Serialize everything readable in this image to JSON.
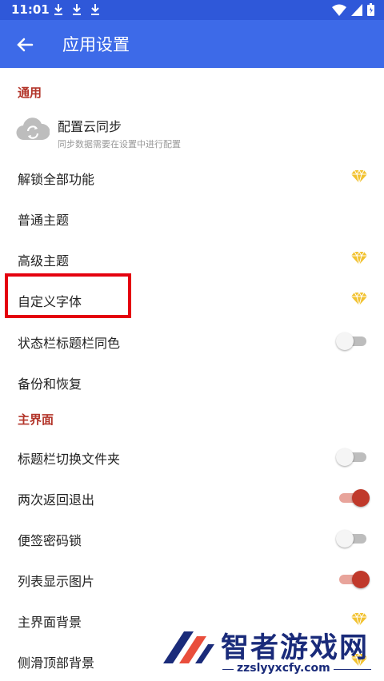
{
  "status": {
    "time": "11:01"
  },
  "appbar": {
    "title": "应用设置"
  },
  "sections": {
    "general": "通用",
    "main": "主界面"
  },
  "cloud_sync": {
    "title": "配置云同步",
    "subtitle": "同步数据需要在设置中进行配置"
  },
  "settings": [
    {
      "label": "解锁全部功能",
      "control": "diamond"
    },
    {
      "label": "普通主题",
      "control": "none"
    },
    {
      "label": "高级主题",
      "control": "diamond"
    },
    {
      "label": "自定义字体",
      "control": "diamond"
    },
    {
      "label": "状态栏标题栏同色",
      "control": "toggle",
      "value": false
    },
    {
      "label": "备份和恢复",
      "control": "none"
    },
    {
      "label": "标题栏切换文件夹",
      "control": "toggle",
      "value": false
    },
    {
      "label": "两次返回退出",
      "control": "toggle",
      "value": true
    },
    {
      "label": "便签密码锁",
      "control": "toggle",
      "value": false
    },
    {
      "label": "列表显示图片",
      "control": "toggle",
      "value": true
    },
    {
      "label": "主界面背景",
      "control": "diamond"
    },
    {
      "label": "侧滑顶部背景",
      "control": "diamond"
    }
  ],
  "watermark": {
    "title": "智者游戏网",
    "url": "zzslyyxcfy.com"
  },
  "colors": {
    "appbar": "#3d6ae8",
    "statusbar": "#2f58d9",
    "section": "#b3352a",
    "diamond": "#f2c230",
    "toggle_on": "#c0392b",
    "highlight": "#e4000f"
  }
}
